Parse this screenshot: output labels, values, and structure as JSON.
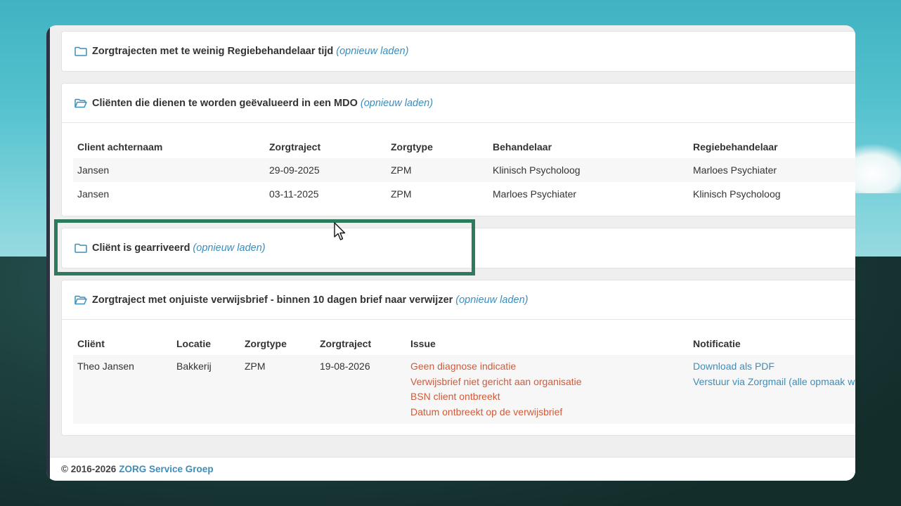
{
  "panels": {
    "p1": {
      "title": "Zorgtrajecten met te weinig Regiebehandelaar tijd",
      "reload": "(opnieuw laden)"
    },
    "p2": {
      "title": "Cliënten die dienen te worden geëvalueerd in een MDO",
      "reload": "(opnieuw laden)",
      "headers": [
        "Client achternaam",
        "Zorgtraject",
        "Zorgtype",
        "Behandelaar",
        "Regiebehandelaar"
      ],
      "rows": [
        [
          "Jansen",
          "29-09-2025",
          "ZPM",
          "Klinisch Psycholoog",
          "Marloes Psychiater"
        ],
        [
          "Jansen",
          "03-11-2025",
          "ZPM",
          "Marloes Psychiater",
          "Klinisch Psycholoog"
        ]
      ]
    },
    "p3": {
      "title": "Cliënt is gearriveerd",
      "reload": "(opnieuw laden)"
    },
    "p4": {
      "title": "Zorgtraject met onjuiste verwijsbrief - binnen 10 dagen brief naar verwijzer",
      "reload": "(opnieuw laden)",
      "headers": [
        "Cliënt",
        "Locatie",
        "Zorgtype",
        "Zorgtraject",
        "Issue",
        "Notificatie"
      ],
      "row": {
        "client": "Theo Jansen",
        "locatie": "Bakkerij",
        "zorgtype": "ZPM",
        "zorgtraject": "19-08-2026",
        "issues": [
          "Geen diagnose indicatie",
          "Verwijsbrief niet gericht aan organisatie",
          "BSN client ontbreekt",
          "Datum ontbreekt op de verwijsbrief"
        ],
        "notifications": [
          "Download als PDF",
          "Verstuur via Zorgmail (alle opmaak w"
        ]
      }
    }
  },
  "footer": {
    "copyright": "© 2016-2026",
    "brand": "ZORG Service Groep"
  },
  "colors": {
    "link": "#3c8dbc",
    "issue": "#d05a3a",
    "highlight": "#2e7a5c"
  }
}
